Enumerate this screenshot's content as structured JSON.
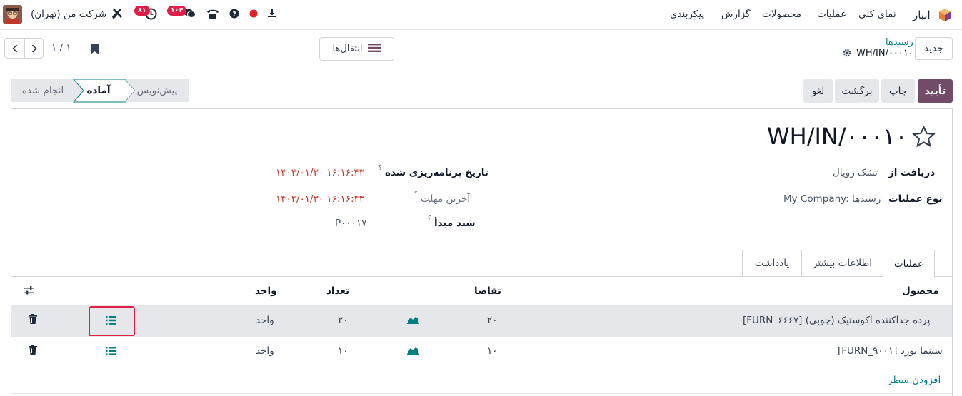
{
  "navbar": {
    "app_name": "انبار",
    "menu": [
      "نمای کلی",
      "عملیات",
      "محصولات",
      "گزارش",
      "پیکربندی"
    ],
    "company": "شرکت من (تهران)",
    "badges": {
      "activities": "۸۱",
      "messages": "۱۰۴"
    }
  },
  "control": {
    "new_button": "جدید",
    "breadcrumb_parent": "رسیدها",
    "record_name": "WH/IN/۰۰۰۱۰",
    "transfers_button": "انتقال‌ها",
    "pager": "۱ / ۱"
  },
  "actions": {
    "validate": "تأیید",
    "print": "چاپ",
    "return": "برگشت",
    "cancel": "لغو"
  },
  "statusbar": {
    "draft": "پیش‌نویس",
    "ready": "آماده",
    "done": "انجام شده"
  },
  "form": {
    "title": "WH/IN/۰۰۰۱۰",
    "receive_from_label": "دریافت از",
    "receive_from_value": "تشک رویال",
    "operation_type_label": "نوع عملیات",
    "operation_type_value": "My Company: رسیدها",
    "scheduled_date_label": "تاریخ برنامه‌ریزی شده",
    "scheduled_date_value": "۱۴۰۴/۰۱/۳۰ ۱۶:۱۶:۴۳",
    "deadline_label": "آخرین مهلت",
    "deadline_value": "۱۴۰۴/۰۱/۳۰ ۱۶:۱۶:۴۳",
    "source_label": "سند مبدأ",
    "source_value": "P۰۰۰۱۷",
    "help_mark": "؟"
  },
  "tabs": [
    "عملیات",
    "اطلاعات بیشتر",
    "یادداشت"
  ],
  "table": {
    "headers": {
      "product": "محصول",
      "demand": "تقاضا",
      "quantity": "تعداد",
      "unit": "واحد"
    },
    "rows": [
      {
        "product": "[FURN_۶۶۶۷] پرده جداکننده آکوستیک (چوبی)",
        "demand": "۲۰",
        "quantity": "۲۰",
        "unit": "واحد"
      },
      {
        "product": "[FURN_۹۰۰۱] سینما بورد",
        "demand": "۱۰",
        "quantity": "۱۰",
        "unit": "واحد"
      }
    ],
    "add_line": "افزودن سطر"
  },
  "colors": {
    "primary": "#714b67",
    "link": "#017e84",
    "highlight_box": "#e11d48"
  }
}
